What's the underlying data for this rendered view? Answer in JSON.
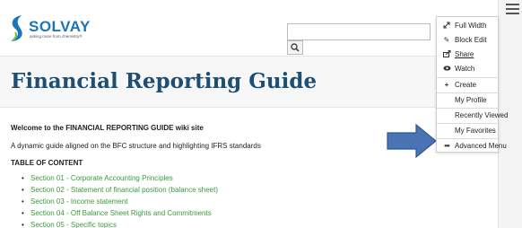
{
  "logo": {
    "brand": "SOLVAY",
    "tagline": "asking more from chemistry®"
  },
  "search": {
    "placeholder": "",
    "button_icon": "search-icon"
  },
  "page": {
    "title": "Financial Reporting Guide"
  },
  "content": {
    "welcome": "Welcome to the FINANCIAL REPORTING GUIDE wiki site",
    "intro": "A dynamic guide aligned on the BFC structure and highlighting IFRS standards",
    "toc_heading": "TABLE OF CONTENT",
    "sections": [
      "Section 01 - Corporate Accounting Principles",
      "Section 02 - Statement of financial position (balance sheet)",
      "Section 03 - Income statement",
      "Section 04 - Off Balance Sheet Rights and Commitments",
      "Section 05 - Specific topics"
    ]
  },
  "menu": {
    "toggle_icon": "hamburger-icon",
    "items": [
      {
        "label": "Full Width",
        "icon": "expand-icon"
      },
      {
        "label": "Block Edit",
        "icon": "pencil-icon"
      },
      {
        "label": "Share",
        "icon": "share-icon"
      },
      {
        "label": "Watch",
        "icon": "eye-icon"
      },
      {
        "label": "Create",
        "icon": "plus-icon"
      },
      {
        "label": "My Profile",
        "icon": ""
      },
      {
        "label": "Recently Viewed",
        "icon": ""
      },
      {
        "label": "My Favorites",
        "icon": ""
      },
      {
        "label": "Advanced Menu",
        "icon": "more-icon"
      }
    ]
  },
  "colors": {
    "title": "#1d4e74",
    "link": "#3c9a3c",
    "arrow": "#4a73b4"
  }
}
